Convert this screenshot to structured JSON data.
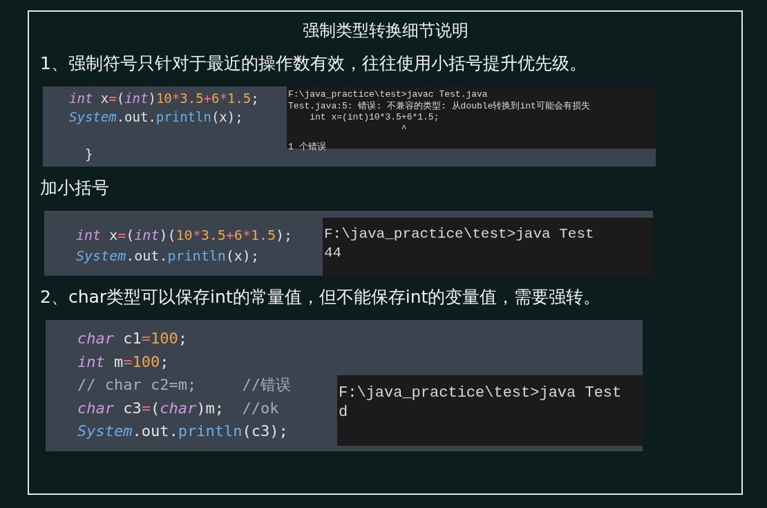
{
  "title": "强制类型转换细节说明",
  "blocks": [
    {
      "kind": "heading",
      "text": "1、强制符号只针对于最近的操作数有效，往往使用小括号提升优先级。"
    },
    {
      "kind": "snippet",
      "code": [
        {
          "kind": "code",
          "tokens": [
            {
              "kind": "keyword",
              "text": "int"
            },
            {
              "kind": "plain",
              "text": " x"
            },
            {
              "kind": "operator",
              "text": "="
            },
            {
              "kind": "plain",
              "text": "("
            },
            {
              "kind": "keyword",
              "text": "int"
            },
            {
              "kind": "plain",
              "text": ")"
            },
            {
              "kind": "number",
              "text": "10"
            },
            {
              "kind": "operator",
              "text": "*"
            },
            {
              "kind": "number",
              "text": "3.5"
            },
            {
              "kind": "operator",
              "text": "+"
            },
            {
              "kind": "number",
              "text": "6"
            },
            {
              "kind": "operator",
              "text": "*"
            },
            {
              "kind": "number",
              "text": "1.5"
            },
            {
              "kind": "plain",
              "text": ";"
            }
          ]
        },
        {
          "kind": "code",
          "tokens": [
            {
              "kind": "class",
              "text": "System"
            },
            {
              "kind": "plain",
              "text": ".out."
            },
            {
              "kind": "method",
              "text": "println"
            },
            {
              "kind": "plain",
              "text": "(x);"
            }
          ]
        },
        {
          "kind": "blank"
        },
        {
          "kind": "code",
          "tokens": [
            {
              "kind": "plain",
              "text": "  }"
            }
          ]
        }
      ],
      "console": [
        "F:\\java_practice\\test>javac Test.java",
        "Test.java:5: 错误: 不兼容的类型: 从double转换到int可能会有损失",
        "    int x=(int)10*3.5+6*1.5;",
        "                     ^",
        "1 个错误"
      ]
    },
    {
      "kind": "heading",
      "text": "加小括号"
    },
    {
      "kind": "snippet",
      "code": [
        {
          "kind": "code",
          "tokens": [
            {
              "kind": "keyword",
              "text": "int"
            },
            {
              "kind": "plain",
              "text": " x"
            },
            {
              "kind": "operator",
              "text": "="
            },
            {
              "kind": "plain",
              "text": "("
            },
            {
              "kind": "keyword",
              "text": "int"
            },
            {
              "kind": "plain",
              "text": ")("
            },
            {
              "kind": "number",
              "text": "10"
            },
            {
              "kind": "operator",
              "text": "*"
            },
            {
              "kind": "number",
              "text": "3.5"
            },
            {
              "kind": "operator",
              "text": "+"
            },
            {
              "kind": "number",
              "text": "6"
            },
            {
              "kind": "operator",
              "text": "*"
            },
            {
              "kind": "number",
              "text": "1.5"
            },
            {
              "kind": "plain",
              "text": ");"
            }
          ]
        },
        {
          "kind": "code",
          "tokens": [
            {
              "kind": "class",
              "text": "System"
            },
            {
              "kind": "plain",
              "text": ".out."
            },
            {
              "kind": "method",
              "text": "println"
            },
            {
              "kind": "plain",
              "text": "(x);"
            }
          ]
        }
      ],
      "console": [
        "F:\\java_practice\\test>java Test",
        "44"
      ]
    },
    {
      "kind": "heading",
      "text": "2、char类型可以保存int的常量值，但不能保存int的变量值，需要强转。"
    },
    {
      "kind": "snippet",
      "code": [
        {
          "kind": "code",
          "tokens": [
            {
              "kind": "keyword",
              "text": "char"
            },
            {
              "kind": "plain",
              "text": " c1"
            },
            {
              "kind": "operator",
              "text": "="
            },
            {
              "kind": "number",
              "text": "100"
            },
            {
              "kind": "plain",
              "text": ";"
            }
          ]
        },
        {
          "kind": "code",
          "tokens": [
            {
              "kind": "keyword",
              "text": "int"
            },
            {
              "kind": "plain",
              "text": " m"
            },
            {
              "kind": "operator",
              "text": "="
            },
            {
              "kind": "number",
              "text": "100"
            },
            {
              "kind": "plain",
              "text": ";"
            }
          ]
        },
        {
          "kind": "code",
          "tokens": [
            {
              "kind": "comment",
              "text": "// char c2=m;     //错误"
            }
          ]
        },
        {
          "kind": "code",
          "tokens": [
            {
              "kind": "keyword",
              "text": "char"
            },
            {
              "kind": "plain",
              "text": " c3"
            },
            {
              "kind": "operator",
              "text": "="
            },
            {
              "kind": "plain",
              "text": "("
            },
            {
              "kind": "keyword",
              "text": "char"
            },
            {
              "kind": "plain",
              "text": ")m;  "
            },
            {
              "kind": "comment",
              "text": "//ok"
            }
          ]
        },
        {
          "kind": "code",
          "tokens": [
            {
              "kind": "class",
              "text": "System"
            },
            {
              "kind": "plain",
              "text": ".out."
            },
            {
              "kind": "method",
              "text": "println"
            },
            {
              "kind": "plain",
              "text": "(c3);"
            }
          ]
        }
      ],
      "console": [
        "F:\\java_practice\\test>java Test",
        "d"
      ]
    }
  ]
}
